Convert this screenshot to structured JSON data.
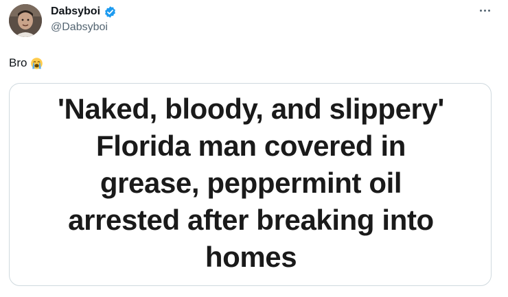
{
  "tweet": {
    "author": {
      "display_name": "Dabsyboi",
      "handle": "@Dabsyboi",
      "verified": true,
      "avatar_icon": "profile-photo"
    },
    "text": "Bro",
    "emoji": "loudly-crying-face",
    "more_icon": "ellipsis-icon",
    "media": {
      "headline_lines": [
        "'Naked, bloody, and slippery'",
        "Florida man covered in",
        "grease, peppermint oil",
        "arrested after breaking into",
        "homes"
      ]
    }
  },
  "colors": {
    "text_primary": "#0f1419",
    "text_secondary": "#536471",
    "verified_blue": "#1d9bf0",
    "card_border": "#cfd9de"
  }
}
